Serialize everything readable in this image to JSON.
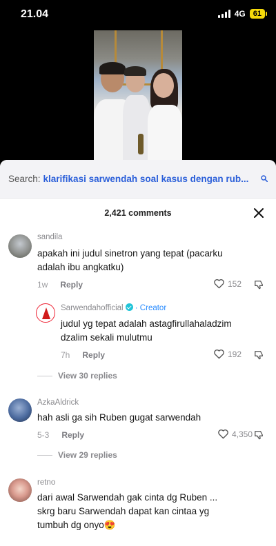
{
  "status_bar": {
    "time": "21.04",
    "network": "4G",
    "battery": "61"
  },
  "search": {
    "prefix": "Search:",
    "query": "klarifikasi sarwendah soal kasus dengan rub..."
  },
  "comments_header": {
    "count_label": "2,421 comments"
  },
  "comments": [
    {
      "username": "sandila",
      "text_lines": [
        "apakah ini judul sinetron yang tepat (pacarku",
        "adalah ibu angkatku)"
      ],
      "time": "1w",
      "reply_label": "Reply",
      "likes": "152",
      "replies": [
        {
          "username": "Sarwendahofficial",
          "badge": "· Creator",
          "text_lines": [
            "judul yg tepat adalah astagfirullahaladzim",
            "dzalim sekali mulutmu"
          ],
          "time": "7h",
          "reply_label": "Reply",
          "likes": "192"
        }
      ],
      "view_replies": "View 30 replies"
    },
    {
      "username": "AzkaAldrick",
      "text_lines": [
        "hah asli ga sih Ruben gugat sarwendah"
      ],
      "time": "5-3",
      "reply_label": "Reply",
      "likes": "4,350",
      "view_replies": "View 29 replies"
    },
    {
      "username": "retno",
      "text_lines": [
        "dari awal Sarwendah gak cinta dg Ruben ...",
        "skrg baru Sarwendah dapat kan cintaa yg",
        "tumbuh dg onyo😍"
      ]
    }
  ],
  "colors": {
    "link": "#2b5fd9",
    "creator": "#2a8cff",
    "battery": "#f5d90a"
  }
}
